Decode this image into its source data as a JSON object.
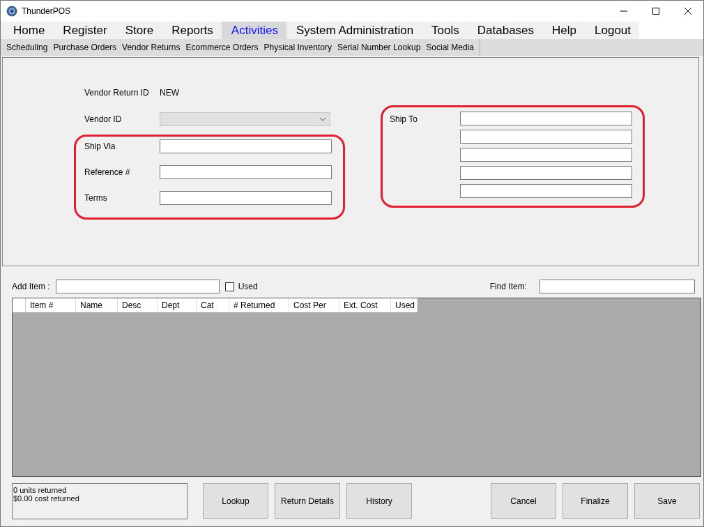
{
  "window": {
    "title": "ThunderPOS"
  },
  "menu": [
    {
      "label": "Home",
      "selected": false
    },
    {
      "label": "Register",
      "selected": false
    },
    {
      "label": "Store",
      "selected": false
    },
    {
      "label": "Reports",
      "selected": false
    },
    {
      "label": "Activities",
      "selected": true
    },
    {
      "label": "System Administration",
      "selected": false
    },
    {
      "label": "Tools",
      "selected": false
    },
    {
      "label": "Databases",
      "selected": false
    },
    {
      "label": "Help",
      "selected": false
    },
    {
      "label": "Logout",
      "selected": false
    }
  ],
  "submenu": [
    "Scheduling",
    "Purchase Orders",
    "Vendor Returns",
    "Ecommerce Orders",
    "Physical Inventory",
    "Serial Number Lookup",
    "Social Media"
  ],
  "form": {
    "vendor_return_id": {
      "label": "Vendor Return ID",
      "value": "NEW"
    },
    "vendor_id": {
      "label": "Vendor ID",
      "disabled": true
    },
    "highlighted_fields": [
      {
        "label": "Ship Via"
      },
      {
        "label": "Reference #"
      },
      {
        "label": "Terms"
      }
    ],
    "ship_to": {
      "label": "Ship To"
    }
  },
  "add_item": {
    "label": "Add Item :"
  },
  "used_checkbox": {
    "label": "Used",
    "checked": false
  },
  "find_item": {
    "label": "Find Item:"
  },
  "table": {
    "columns": [
      "Item #",
      "Name",
      "Desc",
      "Dept",
      "Cat",
      "# Returned",
      "Cost Per",
      "Ext. Cost",
      "Used"
    ]
  },
  "summary": [
    "0 units returned",
    "$0.00 cost returned"
  ],
  "buttons_left": [
    "Lookup",
    "Return Details",
    "History"
  ],
  "buttons_right": [
    "Cancel",
    "Finalize",
    "Save"
  ]
}
